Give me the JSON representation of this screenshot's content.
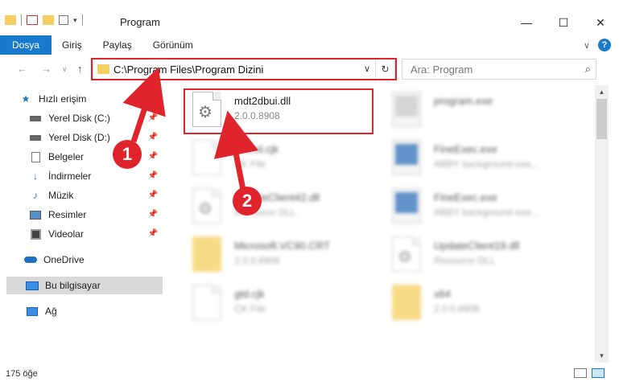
{
  "window": {
    "title": "Program",
    "minimize": "—",
    "maximize": "☐",
    "close": "✕"
  },
  "ribbon": {
    "tabs": [
      "Dosya",
      "Giriş",
      "Paylaş",
      "Görünüm"
    ],
    "expand": "∨",
    "help": "?"
  },
  "address": {
    "path": "C:\\Program Files\\Program Dizini",
    "dropdown": "∨",
    "refresh": "↻"
  },
  "search": {
    "placeholder": "Ara: Program",
    "icon": "search-icon"
  },
  "nav": {
    "back": "←",
    "forward": "→",
    "recent": "∨",
    "up": "↑",
    "items": [
      {
        "label": "Hızlı erişim",
        "icon": "star-icon",
        "pinned": false
      },
      {
        "label": "Yerel Disk (C:)",
        "icon": "drive-icon",
        "pinned": true
      },
      {
        "label": "Yerel Disk (D:)",
        "icon": "drive-icon",
        "pinned": true
      },
      {
        "label": "Belgeler",
        "icon": "documents-icon",
        "pinned": true
      },
      {
        "label": "İndirmeler",
        "icon": "download-icon",
        "pinned": true
      },
      {
        "label": "Müzik",
        "icon": "music-icon",
        "pinned": true
      },
      {
        "label": "Resimler",
        "icon": "pictures-icon",
        "pinned": true
      },
      {
        "label": "Videolar",
        "icon": "videos-icon",
        "pinned": true
      },
      {
        "label": "OneDrive",
        "icon": "cloud-icon",
        "pinned": false
      },
      {
        "label": "Bu bilgisayar",
        "icon": "computer-icon",
        "pinned": false,
        "selected": true
      },
      {
        "label": "Ağ",
        "icon": "network-icon",
        "pinned": false
      }
    ]
  },
  "files": [
    {
      "name": "mdt2dbui.dll",
      "sub": "2.0.0.8908",
      "icon": "dll-icon",
      "highlighted": true
    },
    {
      "name": "program.exe",
      "sub": "",
      "icon": "exe-icon"
    },
    {
      "name": "clrtrml.cjk",
      "sub": "CK File",
      "icon": "file-icon"
    },
    {
      "name": "FineExec.exe",
      "sub": "ABBY background exe...",
      "icon": "exe-icon"
    },
    {
      "name": "UpdateClient42.dll",
      "sub": "Resource DLL",
      "icon": "dll-icon"
    },
    {
      "name": "FineExec.exe",
      "sub": "ABBY background exe...",
      "icon": "exe-icon"
    },
    {
      "name": "Microsoft.VC90.CRT",
      "sub": "2.0.0.8908",
      "icon": "folder-icon"
    },
    {
      "name": "UpdateClient19.dll",
      "sub": "Resource DLL",
      "icon": "dll-icon"
    },
    {
      "name": "gtd.cjk",
      "sub": "CK File",
      "icon": "file-icon"
    },
    {
      "name": "x64",
      "sub": "2.0.0.8908",
      "icon": "folder-icon"
    }
  ],
  "status": {
    "count": "175 öğe"
  },
  "annotations": [
    {
      "number": "1"
    },
    {
      "number": "2"
    }
  ],
  "colors": {
    "accent": "#1979ca",
    "annotation": "#e0242b",
    "selection": "#d9d9d9"
  }
}
